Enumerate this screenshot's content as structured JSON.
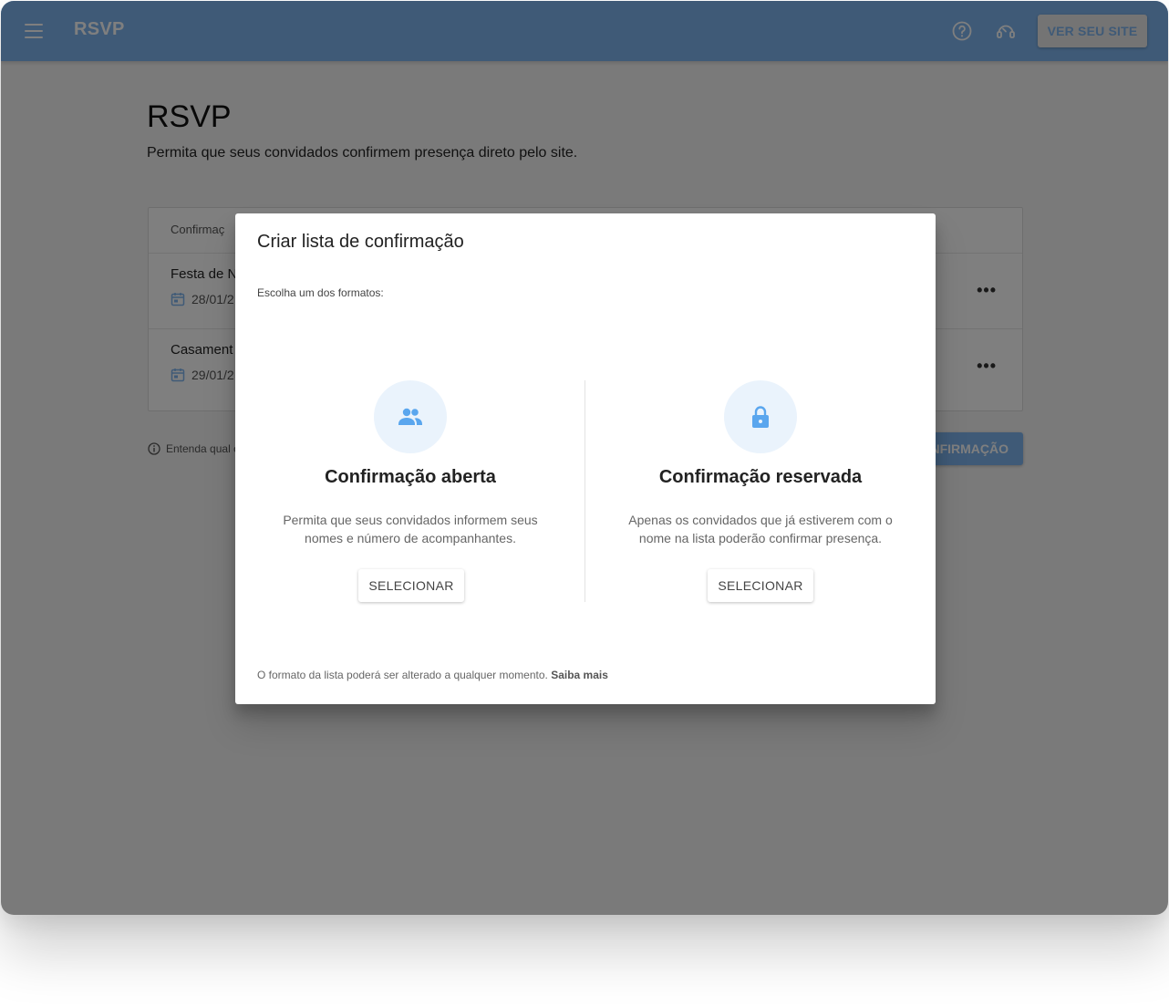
{
  "appbar": {
    "title": "RSVP",
    "view_site_label": "VER SEU SITE",
    "icons": [
      "menu-icon",
      "help-icon",
      "support-icon"
    ]
  },
  "page": {
    "title": "RSVP",
    "subtitle": "Permita que seus convidados confirmem presença direto pelo site."
  },
  "list": {
    "header": "Confirmaç",
    "rows": [
      {
        "name": "Festa de N",
        "date": "28/01/2"
      },
      {
        "name": "Casament",
        "date": "29/01/2"
      }
    ],
    "more_label": "•••"
  },
  "info_note": "Entenda qual c",
  "create_button_label": "NFIRMAÇÃO",
  "modal": {
    "title": "Criar lista de confirmação",
    "subtitle": "Escolha um dos formatos:",
    "options": [
      {
        "icon": "group-icon",
        "title": "Confirmação aberta",
        "description": "Permita que seus convidados informem seus nomes e número de acompanhantes.",
        "button_label": "SELECIONAR"
      },
      {
        "icon": "lock-icon",
        "title": "Confirmação reservada",
        "description": "Apenas os convidados que já estiverem com o nome na lista poderão confirmar presença.",
        "button_label": "SELECIONAR"
      }
    ],
    "footer_text": "O formato da lista poderá ser alterado a qualquer momento.",
    "footer_link": "Saiba mais"
  },
  "colors": {
    "primary": "#7fb5ee",
    "icon_circle": "#eaf3fc",
    "overlay": "rgba(0,0,0,0.5)"
  }
}
